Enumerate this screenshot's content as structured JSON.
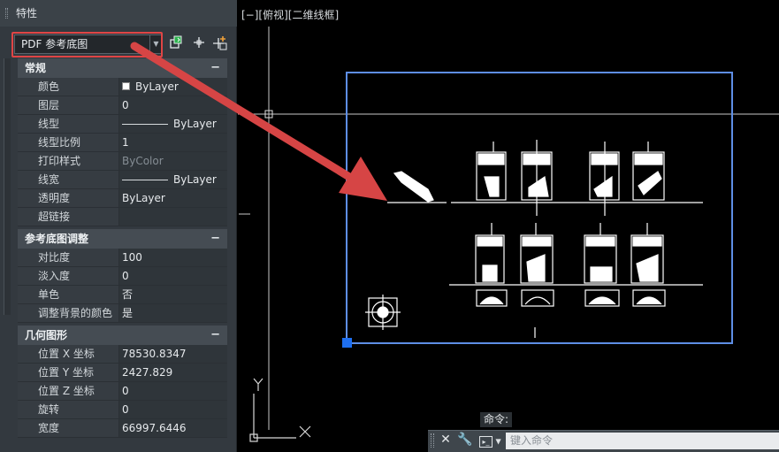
{
  "palette": {
    "title": "特性",
    "selector_value": "PDF 参考底图",
    "tools": {
      "quick_select_icon": "quick-select-icon",
      "select_objects_icon": "select-objects-icon",
      "pickadd_icon": "pickadd-toggle-icon"
    },
    "sections": {
      "general": {
        "title": "常规",
        "rows": [
          {
            "key": "颜色",
            "value": "ByLayer"
          },
          {
            "key": "图层",
            "value": "0"
          },
          {
            "key": "线型",
            "value": "ByLayer"
          },
          {
            "key": "线型比例",
            "value": "1"
          },
          {
            "key": "打印样式",
            "value": "ByColor"
          },
          {
            "key": "线宽",
            "value": "ByLayer"
          },
          {
            "key": "透明度",
            "value": "ByLayer"
          },
          {
            "key": "超链接",
            "value": ""
          }
        ]
      },
      "underlay": {
        "title": "参考底图调整",
        "rows": [
          {
            "key": "对比度",
            "value": "100"
          },
          {
            "key": "淡入度",
            "value": "0"
          },
          {
            "key": "单色",
            "value": "否"
          },
          {
            "key": "调整背景的颜色",
            "value": "是"
          }
        ]
      },
      "geometry": {
        "title": "几何图形",
        "rows": [
          {
            "key": "位置 X 坐标",
            "value": "78530.8347"
          },
          {
            "key": "位置 Y 坐标",
            "value": "2427.829"
          },
          {
            "key": "位置 Z 坐标",
            "value": "0"
          },
          {
            "key": "旋转",
            "value": "0"
          },
          {
            "key": "宽度",
            "value": "66997.6446"
          }
        ]
      }
    },
    "collapse_symbol": "−"
  },
  "viewport": {
    "label": "[−][俯视][二维线框]",
    "ucs_x": "X",
    "ucs_y": "Y"
  },
  "command": {
    "tab_label": "命令:",
    "prompt": "▸_",
    "placeholder": "键入命令",
    "close_icon": "close-icon",
    "customize_icon": "wrench-icon"
  },
  "colors": {
    "annotation_arrow": "#d64545",
    "selection_frame": "#5e8ee6",
    "grip": "#1e6ff0"
  }
}
